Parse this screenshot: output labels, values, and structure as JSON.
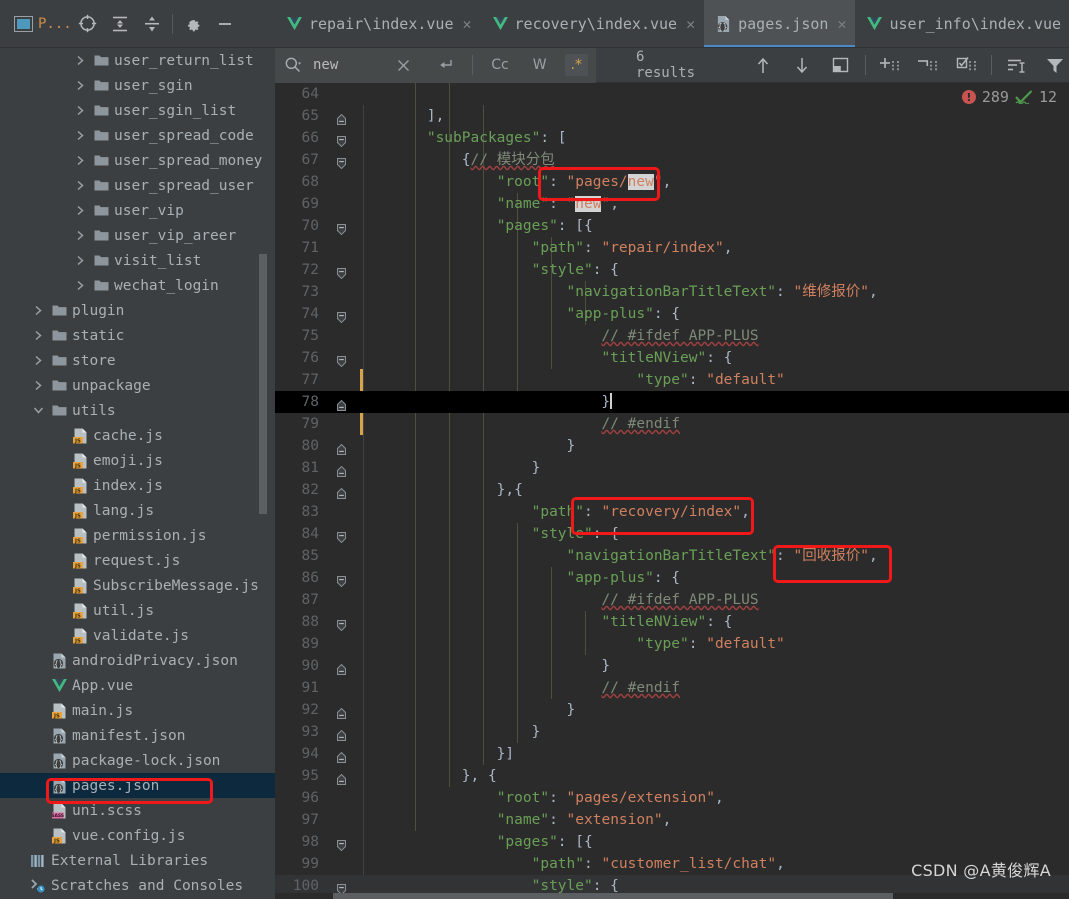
{
  "toolbar": {
    "project_label": "P...",
    "icons": [
      "project-icon",
      "locate-icon",
      "expand-all-icon",
      "collapse-all-icon",
      "settings-icon",
      "minimize-icon"
    ]
  },
  "tabs": [
    {
      "label": "repair\\index.vue",
      "icon": "vue-icon",
      "active": false,
      "closable": true
    },
    {
      "label": "recovery\\index.vue",
      "icon": "vue-icon",
      "active": false,
      "closable": true
    },
    {
      "label": "pages.json",
      "icon": "json-icon",
      "active": true,
      "closable": true
    },
    {
      "label": "user_info\\index.vue",
      "icon": "vue-icon",
      "active": false,
      "closable": false
    }
  ],
  "search": {
    "value": "new",
    "placeholder": "Search",
    "results_text": "6 results",
    "options": [
      {
        "label": "Cc",
        "name": "match-case-toggle",
        "on": false
      },
      {
        "label": "W",
        "name": "words-toggle",
        "on": false
      },
      {
        "label": ".*",
        "name": "regex-toggle",
        "on": true
      }
    ],
    "actions": [
      "close-icon",
      "reset-icon",
      "prev-match-icon",
      "next-match-icon",
      "open-in-find-window-icon",
      "add-selection-icon",
      "remove-selection-icon",
      "select-all-occurrences-icon",
      "filter-list-icon",
      "filter-icon"
    ]
  },
  "sidebar": {
    "items": [
      {
        "label": "user_return_list",
        "type": "folder",
        "depth": 3,
        "arrow": "right"
      },
      {
        "label": "user_sgin",
        "type": "folder",
        "depth": 3,
        "arrow": "right"
      },
      {
        "label": "user_sgin_list",
        "type": "folder",
        "depth": 3,
        "arrow": "right"
      },
      {
        "label": "user_spread_code",
        "type": "folder",
        "depth": 3,
        "arrow": "right"
      },
      {
        "label": "user_spread_money",
        "type": "folder",
        "depth": 3,
        "arrow": "right"
      },
      {
        "label": "user_spread_user",
        "type": "folder",
        "depth": 3,
        "arrow": "right"
      },
      {
        "label": "user_vip",
        "type": "folder",
        "depth": 3,
        "arrow": "right"
      },
      {
        "label": "user_vip_areer",
        "type": "folder",
        "depth": 3,
        "arrow": "right"
      },
      {
        "label": "visit_list",
        "type": "folder",
        "depth": 3,
        "arrow": "right"
      },
      {
        "label": "wechat_login",
        "type": "folder",
        "depth": 3,
        "arrow": "right"
      },
      {
        "label": "plugin",
        "type": "folder",
        "depth": 1,
        "arrow": "right"
      },
      {
        "label": "static",
        "type": "folder",
        "depth": 1,
        "arrow": "right"
      },
      {
        "label": "store",
        "type": "folder",
        "depth": 1,
        "arrow": "right"
      },
      {
        "label": "unpackage",
        "type": "folder",
        "depth": 1,
        "arrow": "right"
      },
      {
        "label": "utils",
        "type": "folder",
        "depth": 1,
        "arrow": "down"
      },
      {
        "label": "cache.js",
        "type": "js",
        "depth": 2,
        "arrow": "none"
      },
      {
        "label": "emoji.js",
        "type": "js",
        "depth": 2,
        "arrow": "none"
      },
      {
        "label": "index.js",
        "type": "js",
        "depth": 2,
        "arrow": "none"
      },
      {
        "label": "lang.js",
        "type": "js",
        "depth": 2,
        "arrow": "none"
      },
      {
        "label": "permission.js",
        "type": "js",
        "depth": 2,
        "arrow": "none"
      },
      {
        "label": "request.js",
        "type": "js",
        "depth": 2,
        "arrow": "none"
      },
      {
        "label": "SubscribeMessage.js",
        "type": "js",
        "depth": 2,
        "arrow": "none"
      },
      {
        "label": "util.js",
        "type": "js",
        "depth": 2,
        "arrow": "none"
      },
      {
        "label": "validate.js",
        "type": "js",
        "depth": 2,
        "arrow": "none"
      },
      {
        "label": "androidPrivacy.json",
        "type": "json",
        "depth": 1,
        "arrow": "none"
      },
      {
        "label": "App.vue",
        "type": "vue",
        "depth": 1,
        "arrow": "none"
      },
      {
        "label": "main.js",
        "type": "js",
        "depth": 1,
        "arrow": "none"
      },
      {
        "label": "manifest.json",
        "type": "json",
        "depth": 1,
        "arrow": "none"
      },
      {
        "label": "package-lock.json",
        "type": "json",
        "depth": 1,
        "arrow": "none"
      },
      {
        "label": "pages.json",
        "type": "json",
        "depth": 1,
        "arrow": "none",
        "selected": true,
        "highlighted": true
      },
      {
        "label": "uni.scss",
        "type": "scss",
        "depth": 1,
        "arrow": "none"
      },
      {
        "label": "vue.config.js",
        "type": "js",
        "depth": 1,
        "arrow": "none"
      },
      {
        "label": "External Libraries",
        "type": "library",
        "depth": 0,
        "arrow": "none"
      },
      {
        "label": "Scratches and Consoles",
        "type": "scratch",
        "depth": 0,
        "arrow": "none"
      }
    ]
  },
  "inspections": {
    "error_count": "289",
    "warning_count": "12",
    "error_icon": "error-circle-icon",
    "check_icon": "green-check-icon"
  },
  "editor": {
    "file": "pages.json",
    "current_line": 78,
    "first_line": 64,
    "lines": [
      {
        "n": 64,
        "text": ""
      },
      {
        "n": 65,
        "text": "        ],",
        "fold": "collapsed-end"
      },
      {
        "n": 66,
        "text": "        \"subPackages\": [",
        "fold": "expanded"
      },
      {
        "n": 67,
        "text": "            {// 模块分包",
        "fold": "expanded"
      },
      {
        "n": 68,
        "text": "                \"root\": \"pages/new\","
      },
      {
        "n": 69,
        "text": "                \"name\": \"new\","
      },
      {
        "n": 70,
        "text": "                \"pages\": [{",
        "fold": "expanded"
      },
      {
        "n": 71,
        "text": "                    \"path\": \"repair/index\","
      },
      {
        "n": 72,
        "text": "                    \"style\": {",
        "fold": "expanded"
      },
      {
        "n": 73,
        "text": "                        \"navigationBarTitleText\": \"维修报价\","
      },
      {
        "n": 74,
        "text": "                        \"app-plus\": {",
        "fold": "expanded"
      },
      {
        "n": 75,
        "text": "                            // #ifdef APP-PLUS"
      },
      {
        "n": 76,
        "text": "                            \"titleNView\": {",
        "fold": "expanded"
      },
      {
        "n": 77,
        "text": "                                \"type\": \"default\""
      },
      {
        "n": 78,
        "text": "                            }",
        "fold": "end",
        "current": true
      },
      {
        "n": 79,
        "text": "                            // #endif"
      },
      {
        "n": 80,
        "text": "                        }",
        "fold": "end"
      },
      {
        "n": 81,
        "text": "                    }",
        "fold": "end"
      },
      {
        "n": 82,
        "text": "                },{",
        "fold": "end"
      },
      {
        "n": 83,
        "text": "                    \"path\": \"recovery/index\","
      },
      {
        "n": 84,
        "text": "                    \"style\": {",
        "fold": "expanded"
      },
      {
        "n": 85,
        "text": "                        \"navigationBarTitleText\": \"回收报价\","
      },
      {
        "n": 86,
        "text": "                        \"app-plus\": {",
        "fold": "expanded"
      },
      {
        "n": 87,
        "text": "                            // #ifdef APP-PLUS"
      },
      {
        "n": 88,
        "text": "                            \"titleNView\": {",
        "fold": "expanded"
      },
      {
        "n": 89,
        "text": "                                \"type\": \"default\""
      },
      {
        "n": 90,
        "text": "                            }",
        "fold": "end"
      },
      {
        "n": 91,
        "text": "                            // #endif"
      },
      {
        "n": 92,
        "text": "                        }",
        "fold": "end"
      },
      {
        "n": 93,
        "text": "                    }",
        "fold": "end"
      },
      {
        "n": 94,
        "text": "                }]",
        "fold": "end"
      },
      {
        "n": 95,
        "text": "            }, {",
        "fold": "end"
      },
      {
        "n": 96,
        "text": "                \"root\": \"pages/extension\","
      },
      {
        "n": 97,
        "text": "                \"name\": \"extension\","
      },
      {
        "n": 98,
        "text": "                \"pages\": [{",
        "fold": "expanded"
      },
      {
        "n": 99,
        "text": "                    \"path\": \"customer_list/chat\","
      },
      {
        "n": 100,
        "text": "                    \"style\": {",
        "fold": "expanded"
      }
    ]
  },
  "annotations": [
    {
      "name": "highlight-root-value",
      "target": "pages/new"
    },
    {
      "name": "highlight-recovery-path",
      "target": "recovery/index"
    },
    {
      "name": "highlight-recovery-title",
      "target": "回收报价"
    },
    {
      "name": "highlight-pages-json-file",
      "target": "pages.json"
    }
  ],
  "watermark": "CSDN @A黄俊辉A",
  "colors": {
    "accent": "#4a88c7",
    "annotation": "#f01818",
    "key": "#6a9f57",
    "string": "#cf8060",
    "comment": "#808080",
    "editor_bg": "#2b2b2b",
    "chrome_bg": "#3c3f41",
    "selection": "#0d293e"
  }
}
